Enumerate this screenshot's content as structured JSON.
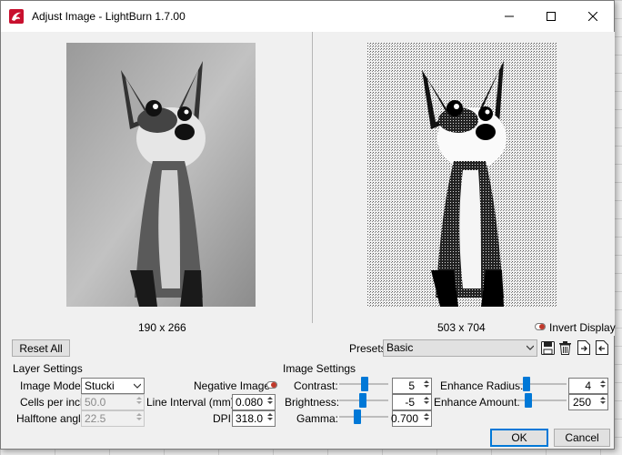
{
  "window": {
    "title": "Adjust Image - LightBurn 1.7.00",
    "minimize_icon": "minimize-icon",
    "maximize_icon": "maximize-icon",
    "close_icon": "close-icon"
  },
  "preview": {
    "original_size": "190 x 266",
    "processed_size": "503 x 704",
    "invert_display_label": "Invert Display"
  },
  "buttons": {
    "reset_all": "Reset All",
    "ok": "OK",
    "cancel": "Cancel"
  },
  "presets": {
    "label": "Presets",
    "value": "Basic",
    "icons": [
      "save-icon",
      "delete-icon",
      "export-icon",
      "import-icon"
    ]
  },
  "layer_settings": {
    "title": "Layer Settings",
    "image_mode_label": "Image Mode:",
    "image_mode_value": "Stucki",
    "negative_image_label": "Negative Image",
    "cells_per_inch_label": "Cells per inch",
    "cells_per_inch_value": "50.0",
    "line_interval_label": "Line Interval (mm)",
    "line_interval_value": "0.080",
    "halftone_angle_label": "Halftone angle",
    "halftone_angle_value": "22.5",
    "dpi_label": "DPI",
    "dpi_value": "318.0"
  },
  "image_settings": {
    "title": "Image Settings",
    "contrast_label": "Contrast:",
    "contrast_value": "5",
    "contrast_level": 0.53,
    "brightness_label": "Brightness:",
    "brightness_value": "-5",
    "brightness_level": 0.47,
    "gamma_label": "Gamma:",
    "gamma_value": "0.700",
    "gamma_level": 0.35,
    "enhance_radius_label": "Enhance Radius:",
    "enhance_radius_value": "4",
    "enhance_radius_level": 0.13,
    "enhance_amount_label": "Enhance Amount:",
    "enhance_amount_value": "250",
    "enhance_amount_level": 0.17
  }
}
